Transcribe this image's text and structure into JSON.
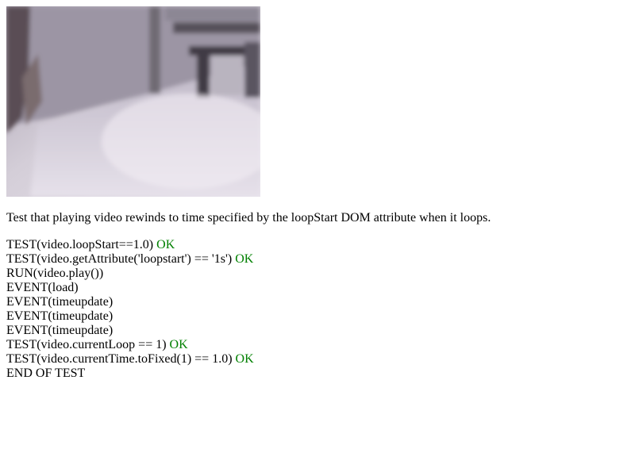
{
  "video_frame": {
    "icon": "video-frame-image"
  },
  "description": "Test that playing video rewinds to time specified by the loopStart DOM attribute when it loops.",
  "log": [
    {
      "text": "TEST(video.loopStart==1.0)",
      "status": "OK"
    },
    {
      "text": "TEST(video.getAttribute('loopstart') == '1s')",
      "status": "OK"
    },
    {
      "text": "RUN(video.play())",
      "status": ""
    },
    {
      "text": "EVENT(load)",
      "status": ""
    },
    {
      "text": "EVENT(timeupdate)",
      "status": ""
    },
    {
      "text": "EVENT(timeupdate)",
      "status": ""
    },
    {
      "text": "EVENT(timeupdate)",
      "status": ""
    },
    {
      "text": "TEST(video.currentLoop == 1)",
      "status": "OK"
    },
    {
      "text": "TEST(video.currentTime.toFixed(1) == 1.0)",
      "status": "OK"
    },
    {
      "text": "END OF TEST",
      "status": ""
    }
  ],
  "colors": {
    "ok": "#008000",
    "text": "#000000"
  }
}
